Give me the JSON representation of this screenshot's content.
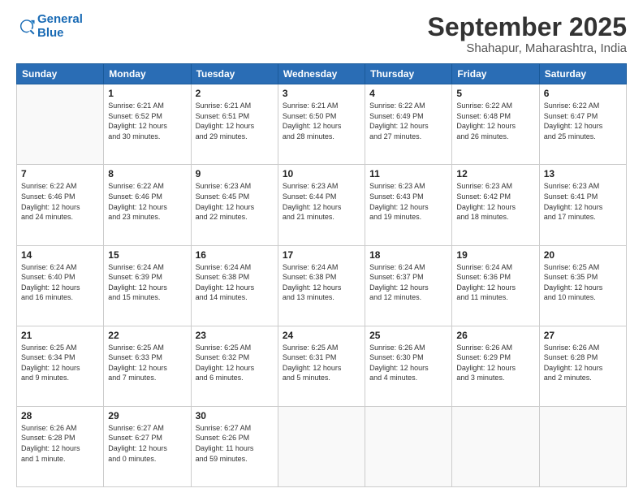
{
  "logo": {
    "line1": "General",
    "line2": "Blue"
  },
  "header": {
    "month": "September 2025",
    "location": "Shahapur, Maharashtra, India"
  },
  "days_header": [
    "Sunday",
    "Monday",
    "Tuesday",
    "Wednesday",
    "Thursday",
    "Friday",
    "Saturday"
  ],
  "weeks": [
    [
      {
        "day": "",
        "info": ""
      },
      {
        "day": "1",
        "info": "Sunrise: 6:21 AM\nSunset: 6:52 PM\nDaylight: 12 hours\nand 30 minutes."
      },
      {
        "day": "2",
        "info": "Sunrise: 6:21 AM\nSunset: 6:51 PM\nDaylight: 12 hours\nand 29 minutes."
      },
      {
        "day": "3",
        "info": "Sunrise: 6:21 AM\nSunset: 6:50 PM\nDaylight: 12 hours\nand 28 minutes."
      },
      {
        "day": "4",
        "info": "Sunrise: 6:22 AM\nSunset: 6:49 PM\nDaylight: 12 hours\nand 27 minutes."
      },
      {
        "day": "5",
        "info": "Sunrise: 6:22 AM\nSunset: 6:48 PM\nDaylight: 12 hours\nand 26 minutes."
      },
      {
        "day": "6",
        "info": "Sunrise: 6:22 AM\nSunset: 6:47 PM\nDaylight: 12 hours\nand 25 minutes."
      }
    ],
    [
      {
        "day": "7",
        "info": "Sunrise: 6:22 AM\nSunset: 6:46 PM\nDaylight: 12 hours\nand 24 minutes."
      },
      {
        "day": "8",
        "info": "Sunrise: 6:22 AM\nSunset: 6:46 PM\nDaylight: 12 hours\nand 23 minutes."
      },
      {
        "day": "9",
        "info": "Sunrise: 6:23 AM\nSunset: 6:45 PM\nDaylight: 12 hours\nand 22 minutes."
      },
      {
        "day": "10",
        "info": "Sunrise: 6:23 AM\nSunset: 6:44 PM\nDaylight: 12 hours\nand 21 minutes."
      },
      {
        "day": "11",
        "info": "Sunrise: 6:23 AM\nSunset: 6:43 PM\nDaylight: 12 hours\nand 19 minutes."
      },
      {
        "day": "12",
        "info": "Sunrise: 6:23 AM\nSunset: 6:42 PM\nDaylight: 12 hours\nand 18 minutes."
      },
      {
        "day": "13",
        "info": "Sunrise: 6:23 AM\nSunset: 6:41 PM\nDaylight: 12 hours\nand 17 minutes."
      }
    ],
    [
      {
        "day": "14",
        "info": "Sunrise: 6:24 AM\nSunset: 6:40 PM\nDaylight: 12 hours\nand 16 minutes."
      },
      {
        "day": "15",
        "info": "Sunrise: 6:24 AM\nSunset: 6:39 PM\nDaylight: 12 hours\nand 15 minutes."
      },
      {
        "day": "16",
        "info": "Sunrise: 6:24 AM\nSunset: 6:38 PM\nDaylight: 12 hours\nand 14 minutes."
      },
      {
        "day": "17",
        "info": "Sunrise: 6:24 AM\nSunset: 6:38 PM\nDaylight: 12 hours\nand 13 minutes."
      },
      {
        "day": "18",
        "info": "Sunrise: 6:24 AM\nSunset: 6:37 PM\nDaylight: 12 hours\nand 12 minutes."
      },
      {
        "day": "19",
        "info": "Sunrise: 6:24 AM\nSunset: 6:36 PM\nDaylight: 12 hours\nand 11 minutes."
      },
      {
        "day": "20",
        "info": "Sunrise: 6:25 AM\nSunset: 6:35 PM\nDaylight: 12 hours\nand 10 minutes."
      }
    ],
    [
      {
        "day": "21",
        "info": "Sunrise: 6:25 AM\nSunset: 6:34 PM\nDaylight: 12 hours\nand 9 minutes."
      },
      {
        "day": "22",
        "info": "Sunrise: 6:25 AM\nSunset: 6:33 PM\nDaylight: 12 hours\nand 7 minutes."
      },
      {
        "day": "23",
        "info": "Sunrise: 6:25 AM\nSunset: 6:32 PM\nDaylight: 12 hours\nand 6 minutes."
      },
      {
        "day": "24",
        "info": "Sunrise: 6:25 AM\nSunset: 6:31 PM\nDaylight: 12 hours\nand 5 minutes."
      },
      {
        "day": "25",
        "info": "Sunrise: 6:26 AM\nSunset: 6:30 PM\nDaylight: 12 hours\nand 4 minutes."
      },
      {
        "day": "26",
        "info": "Sunrise: 6:26 AM\nSunset: 6:29 PM\nDaylight: 12 hours\nand 3 minutes."
      },
      {
        "day": "27",
        "info": "Sunrise: 6:26 AM\nSunset: 6:28 PM\nDaylight: 12 hours\nand 2 minutes."
      }
    ],
    [
      {
        "day": "28",
        "info": "Sunrise: 6:26 AM\nSunset: 6:28 PM\nDaylight: 12 hours\nand 1 minute."
      },
      {
        "day": "29",
        "info": "Sunrise: 6:27 AM\nSunset: 6:27 PM\nDaylight: 12 hours\nand 0 minutes."
      },
      {
        "day": "30",
        "info": "Sunrise: 6:27 AM\nSunset: 6:26 PM\nDaylight: 11 hours\nand 59 minutes."
      },
      {
        "day": "",
        "info": ""
      },
      {
        "day": "",
        "info": ""
      },
      {
        "day": "",
        "info": ""
      },
      {
        "day": "",
        "info": ""
      }
    ]
  ]
}
